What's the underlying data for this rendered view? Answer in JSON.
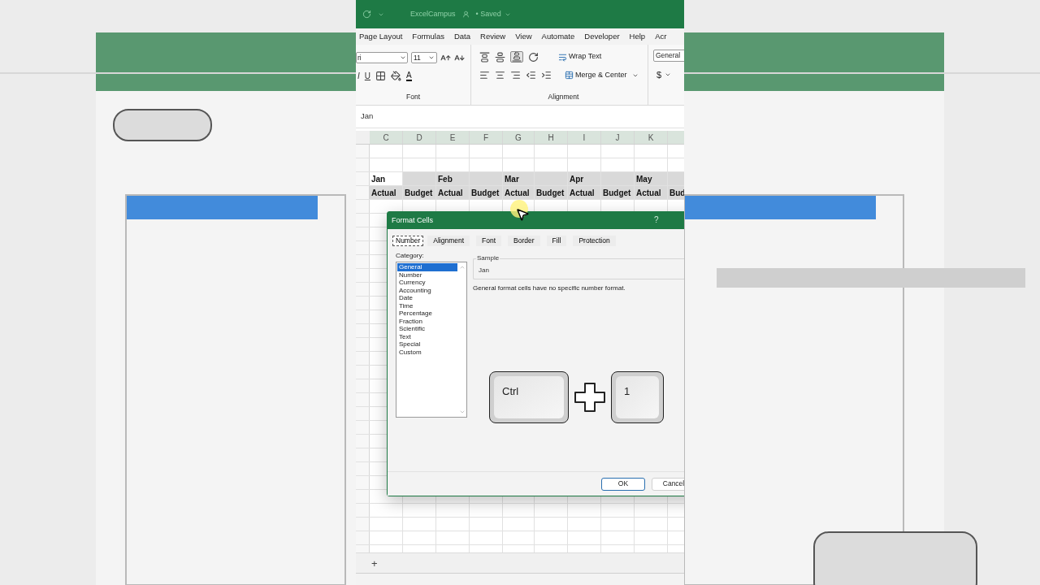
{
  "title_bar": {
    "file_name": "ExcelCampus",
    "saved_status": "• Saved"
  },
  "ribbon_tabs": [
    "Page Layout",
    "Formulas",
    "Data",
    "Review",
    "View",
    "Automate",
    "Developer",
    "Help",
    "Acr"
  ],
  "font_group": {
    "font_name": "ri",
    "font_size": "11",
    "style_buttons": [
      "I",
      "U"
    ],
    "font_color": "A",
    "label": "Font"
  },
  "alignment_group": {
    "wrap_text": "Wrap Text",
    "merge_center": "Merge & Center",
    "label": "Alignment"
  },
  "number_group": {
    "format": "General",
    "currency": "$"
  },
  "formula_bar": {
    "value": "Jan"
  },
  "sheet": {
    "columns": [
      "C",
      "D",
      "E",
      "F",
      "G",
      "H",
      "I",
      "J",
      "K",
      ""
    ],
    "rows": [
      [
        "",
        "",
        "",
        "",
        "",
        "",
        "",
        "",
        "",
        ""
      ],
      [
        "",
        "",
        "",
        "",
        "",
        "",
        "",
        "",
        "",
        ""
      ],
      [
        "Jan",
        "",
        "Feb",
        "",
        "Mar",
        "",
        "Apr",
        "",
        "May",
        ""
      ],
      [
        "Actual",
        "Budget",
        "Actual",
        "Budget",
        "Actual",
        "Budget",
        "Actual",
        "Budget",
        "Actual",
        "Bud"
      ]
    ]
  },
  "dialog": {
    "title": "Format Cells",
    "help": "?",
    "tabs": [
      {
        "label": "Number",
        "selected": true
      },
      {
        "label": "Alignment",
        "selected": false
      },
      {
        "label": "Font",
        "selected": false
      },
      {
        "label": "Border",
        "selected": false
      },
      {
        "label": "Fill",
        "selected": false
      },
      {
        "label": "Protection",
        "selected": false
      }
    ],
    "category_label": "Category:",
    "categories": [
      {
        "label": "General",
        "selected": true
      },
      {
        "label": "Number",
        "selected": false
      },
      {
        "label": "Currency",
        "selected": false
      },
      {
        "label": "Accounting",
        "selected": false
      },
      {
        "label": "Date",
        "selected": false
      },
      {
        "label": "Time",
        "selected": false
      },
      {
        "label": "Percentage",
        "selected": false
      },
      {
        "label": "Fraction",
        "selected": false
      },
      {
        "label": "Scientific",
        "selected": false
      },
      {
        "label": "Text",
        "selected": false
      },
      {
        "label": "Special",
        "selected": false
      },
      {
        "label": "Custom",
        "selected": false
      }
    ],
    "sample_label": "Sample",
    "sample_value": "Jan",
    "description": "General format cells have no specific number format.",
    "shortcut_keys": [
      "Ctrl",
      "1"
    ],
    "buttons": [
      "OK",
      "Cancel"
    ]
  },
  "sheet_bar": {
    "add": "+"
  }
}
